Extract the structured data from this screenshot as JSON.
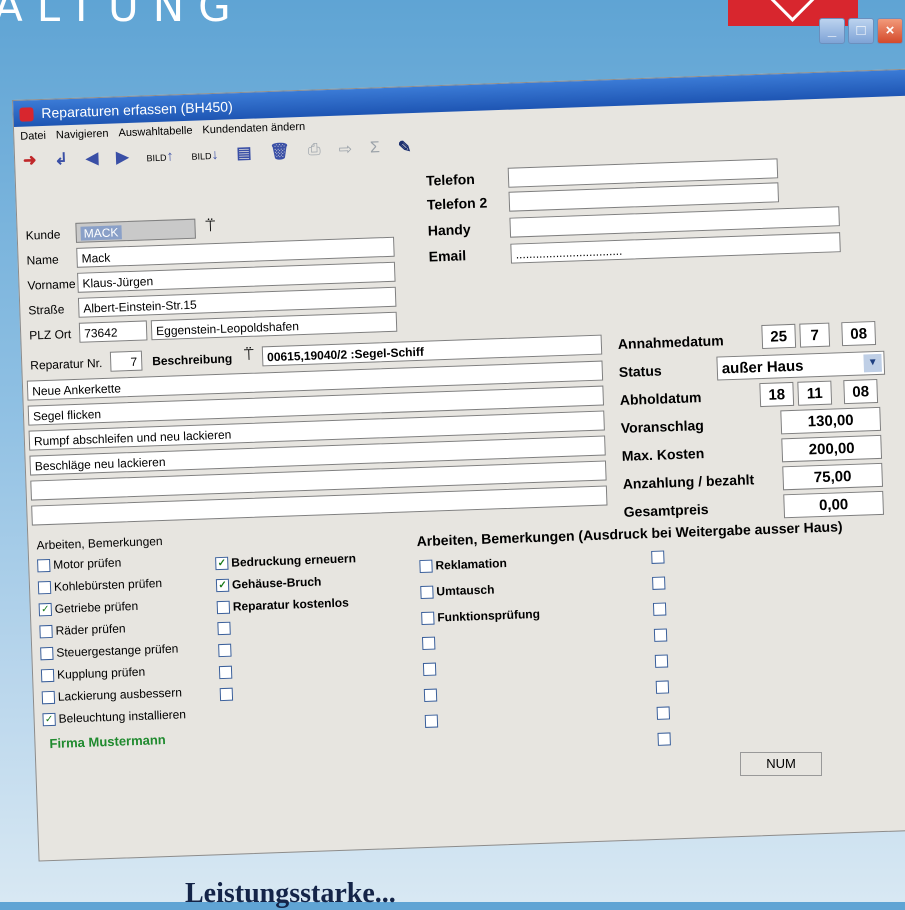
{
  "brand_text": "ALTUNG",
  "window": {
    "title": "Reparaturen erfassen (BH450)"
  },
  "menu": [
    "Datei",
    "Navigieren",
    "Auswahltabelle",
    "Kundendaten ändern"
  ],
  "toolbar": {
    "bild_up": "BILD",
    "bild_down": "BILD"
  },
  "customer": {
    "kunde_label": "Kunde",
    "kunde_value": "MACK",
    "name_label": "Name",
    "name_value": "Mack",
    "vorname_label": "Vorname",
    "vorname_value": "Klaus-Jürgen",
    "strasse_label": "Straße",
    "strasse_value": "Albert-Einstein-Str.15",
    "plzort_label": "PLZ Ort",
    "plz_value": "73642",
    "ort_value": "Eggenstein-Leopoldshafen"
  },
  "contact": {
    "telefon_label": "Telefon",
    "telefon_value": "",
    "telefon2_label": "Telefon 2",
    "telefon2_value": "",
    "handy_label": "Handy",
    "handy_value": "",
    "email_label": "Email",
    "email_value": "................................"
  },
  "repair": {
    "nr_label": "Reparatur Nr.",
    "nr_value": "7",
    "beschreibung_label": "Beschreibung",
    "beschreibung_value": "00615,19040/2 :Segel-Schiff",
    "lines": [
      "Neue Ankerkette",
      "Segel flicken",
      "Rumpf abschleifen und neu lackieren",
      "Beschläge neu lackieren",
      "",
      ""
    ]
  },
  "dates": {
    "annahme_label": "Annahmedatum",
    "annahme_d": "25",
    "annahme_m": "7",
    "annahme_y": "08",
    "status_label": "Status",
    "status_value": "außer Haus",
    "abhol_label": "Abholdatum",
    "abhol_d": "18",
    "abhol_m": "11",
    "abhol_y": "08",
    "voranschlag_label": "Voranschlag",
    "voranschlag_value": "130,00",
    "maxkosten_label": "Max. Kosten",
    "maxkosten_value": "200,00",
    "anzahlung_label": "Anzahlung / bezahlt",
    "anzahlung_value": "75,00",
    "gesamt_label": "Gesamtpreis",
    "gesamt_value": "0,00"
  },
  "work": {
    "heading": "Arbeiten, Bemerkungen",
    "col1": [
      {
        "label": "Motor prüfen",
        "checked": false
      },
      {
        "label": "Kohlebürsten prüfen",
        "checked": false
      },
      {
        "label": "Getriebe prüfen",
        "checked": true
      },
      {
        "label": "Räder prüfen",
        "checked": false
      },
      {
        "label": "Steuergestange prüfen",
        "checked": false
      },
      {
        "label": "Kupplung prüfen",
        "checked": false
      },
      {
        "label": "Lackierung ausbessern",
        "checked": false
      },
      {
        "label": "Beleuchtung installieren",
        "checked": true
      }
    ],
    "col2": [
      {
        "label": "Bedruckung erneuern",
        "checked": true
      },
      {
        "label": "Gehäuse-Bruch",
        "checked": true
      },
      {
        "label": "Reparatur kostenlos",
        "checked": false
      },
      {
        "label": "",
        "checked": false
      },
      {
        "label": "",
        "checked": false
      },
      {
        "label": "",
        "checked": false
      },
      {
        "label": "",
        "checked": false
      }
    ],
    "firma": "Firma Mustermann"
  },
  "work_external": {
    "heading": "Arbeiten, Bemerkungen (Ausdruck bei Weitergabe ausser Haus)",
    "col1": [
      "Reklamation",
      "Umtausch",
      "Funktionsprüfung",
      "",
      "",
      "",
      ""
    ],
    "col2_count": 8
  },
  "statusbar": {
    "num": "NUM"
  },
  "footer_text": "Leistungsstarke..."
}
